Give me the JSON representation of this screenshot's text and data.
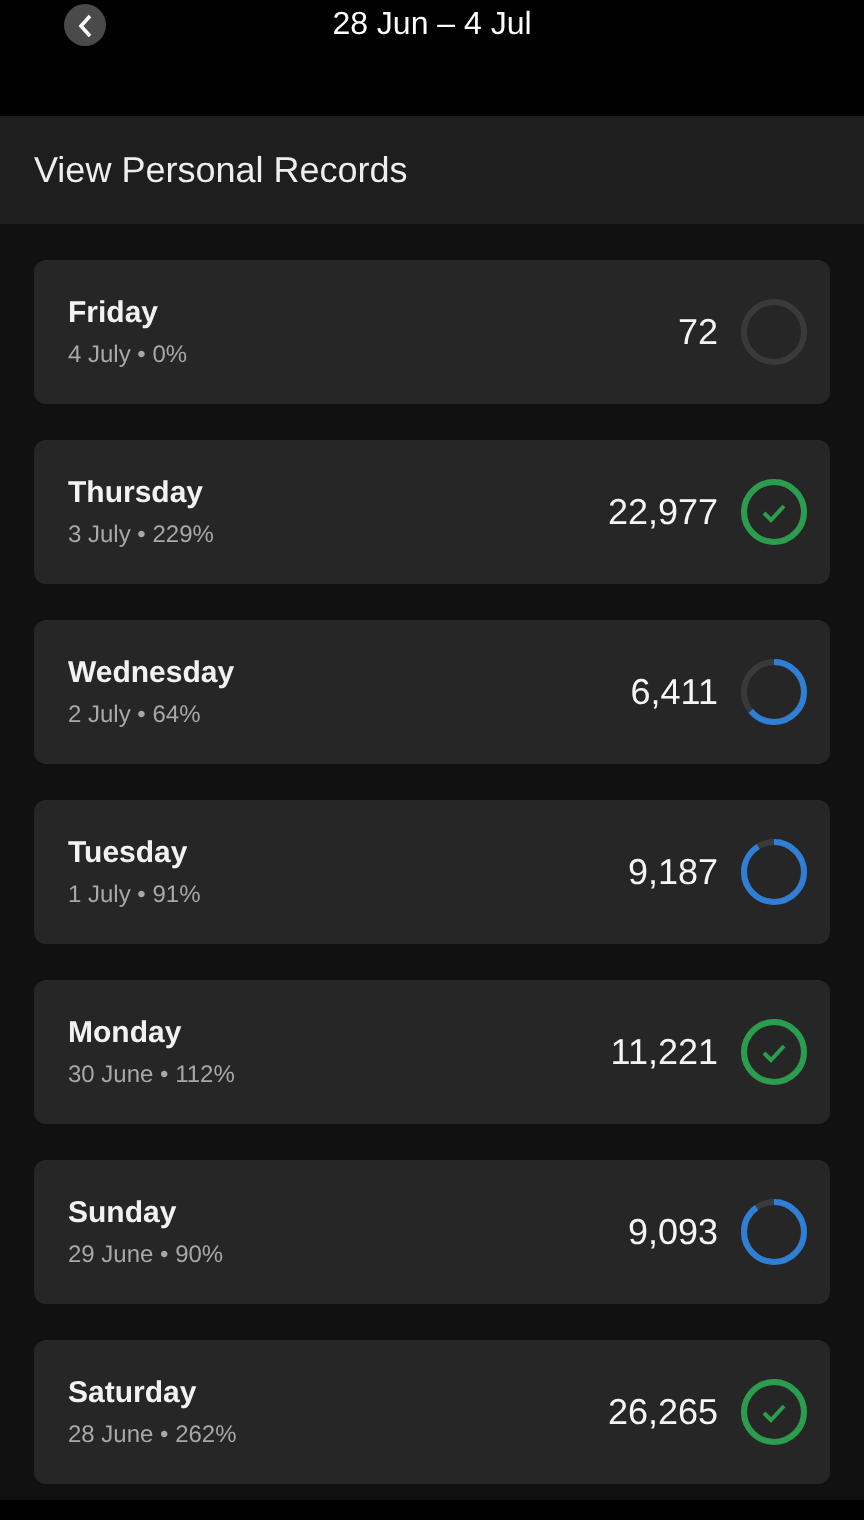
{
  "header": {
    "title": "28 Jun – 4 Jul"
  },
  "section": {
    "title": "View Personal Records"
  },
  "days": [
    {
      "day": "Friday",
      "detail": "4 July • 0%",
      "steps": "72",
      "completed": false
    },
    {
      "day": "Thursday",
      "detail": "3 July • 229%",
      "steps": "22,977",
      "completed": true
    },
    {
      "day": "Wednesday",
      "detail": "2 July • 64%",
      "steps": "6,411",
      "completed": false
    },
    {
      "day": "Tuesday",
      "detail": "1 July • 91%",
      "steps": "9,187",
      "completed": false
    },
    {
      "day": "Monday",
      "detail": "30 June • 112%",
      "steps": "11,221",
      "completed": true
    },
    {
      "day": "Sunday",
      "detail": "29 June • 90%",
      "steps": "9,093",
      "completed": false
    },
    {
      "day": "Saturday",
      "detail": "28 June • 262%",
      "steps": "26,265",
      "completed": true
    }
  ]
}
